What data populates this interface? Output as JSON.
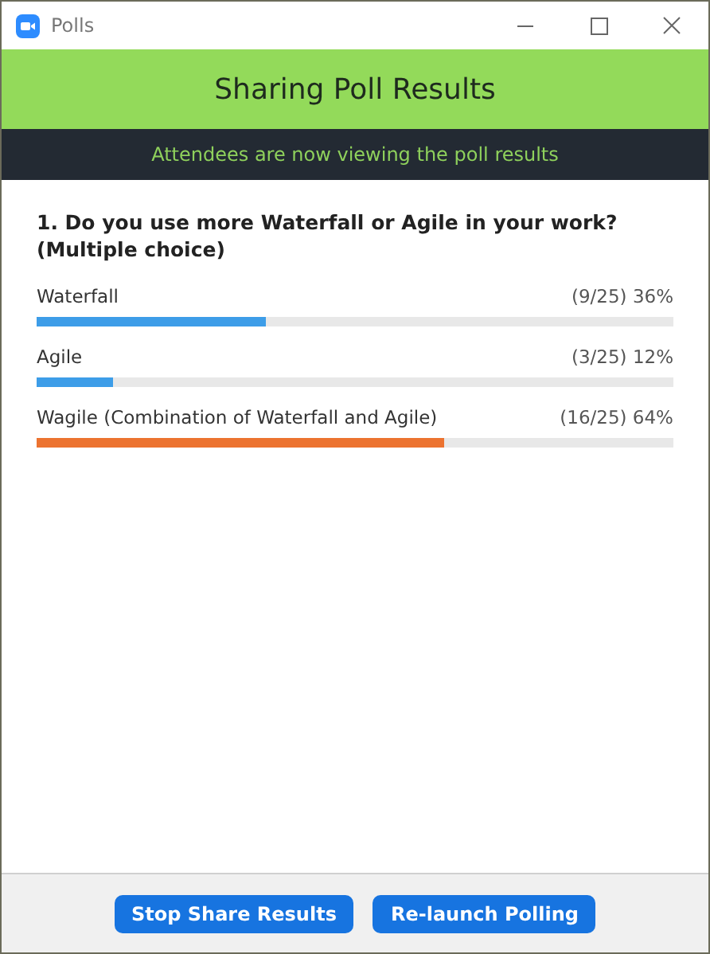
{
  "window": {
    "title": "Polls"
  },
  "banner": {
    "title": "Sharing Poll Results"
  },
  "notice": "Attendees are now viewing the poll results",
  "question": "1. Do you use more Waterfall or Agile in your work? (Multiple choice)",
  "answers": [
    {
      "label": "Waterfall",
      "result": "(9/25) 36%",
      "level": 0.36,
      "color": "#3d9de8"
    },
    {
      "label": "Agile",
      "result": "(3/25) 12%",
      "level": 0.12,
      "color": "#3d9de8"
    },
    {
      "label": "Wagile (Combination of Waterfall and Agile)",
      "result": "(16/25) 64%",
      "level": 0.64,
      "color": "#ec7330"
    }
  ],
  "buttons": [
    "Stop Share Results",
    "Re-launch Polling"
  ]
}
